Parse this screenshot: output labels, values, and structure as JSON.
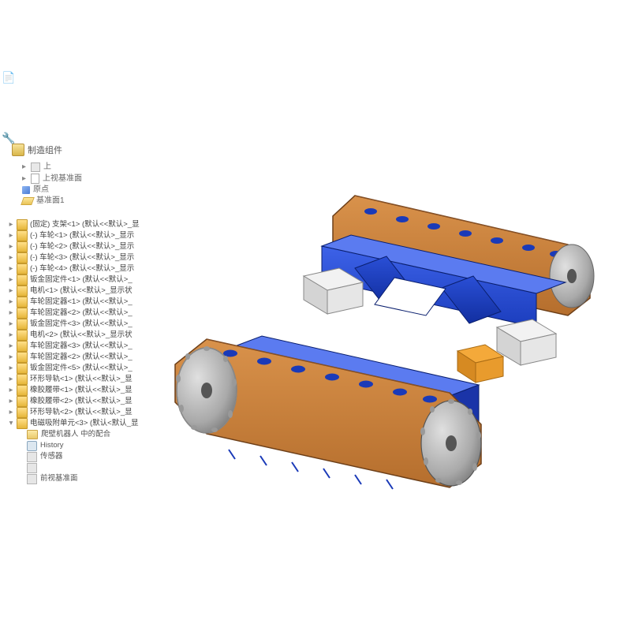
{
  "header": {
    "assembly_label": "制造组件"
  },
  "anchors": {
    "top1": "上",
    "top2": "上视基准面",
    "origin": "原点",
    "plane1": "基准面1"
  },
  "tree": [
    {
      "label": "(固定) 支架<1> (默认<<默认>_显"
    },
    {
      "label": "(-) 车轮<1> (默认<<默认>_显示"
    },
    {
      "label": "(-) 车轮<2> (默认<<默认>_显示"
    },
    {
      "label": "(-) 车轮<3> (默认<<默认>_显示"
    },
    {
      "label": "(-) 车轮<4> (默认<<默认>_显示"
    },
    {
      "label": "钣金固定件<1> (默认<<默认>_"
    },
    {
      "label": "电机<1> (默认<<默认>_显示状"
    },
    {
      "label": "车轮固定器<1> (默认<<默认>_"
    },
    {
      "label": "车轮固定器<2> (默认<<默认>_"
    },
    {
      "label": "钣金固定件<3> (默认<<默认>_"
    },
    {
      "label": "电机<2> (默认<<默认>_显示状"
    },
    {
      "label": "车轮固定器<3> (默认<<默认>_"
    },
    {
      "label": "车轮固定器<2> (默认<<默认>_"
    },
    {
      "label": "钣金固定件<5> (默认<<默认>_"
    },
    {
      "label": "环形导轨<1> (默认<<默认>_显"
    },
    {
      "label": "橡胶履带<1> (默认<<默认>_显"
    },
    {
      "label": "橡胶履带<2> (默认<<默认>_显"
    },
    {
      "label": "环形导轨<2> (默认<<默认>_显"
    },
    {
      "label": "电磁吸附单元<3> (默认<默认_显",
      "open": true
    }
  ],
  "sub": {
    "mates": "爬壁机器人 中的配合",
    "history": "History",
    "sensor": "传感器",
    "notes": " ",
    "front": "前视基准面"
  },
  "icons": {
    "rail1": "📄",
    "rail2": "🔧"
  }
}
